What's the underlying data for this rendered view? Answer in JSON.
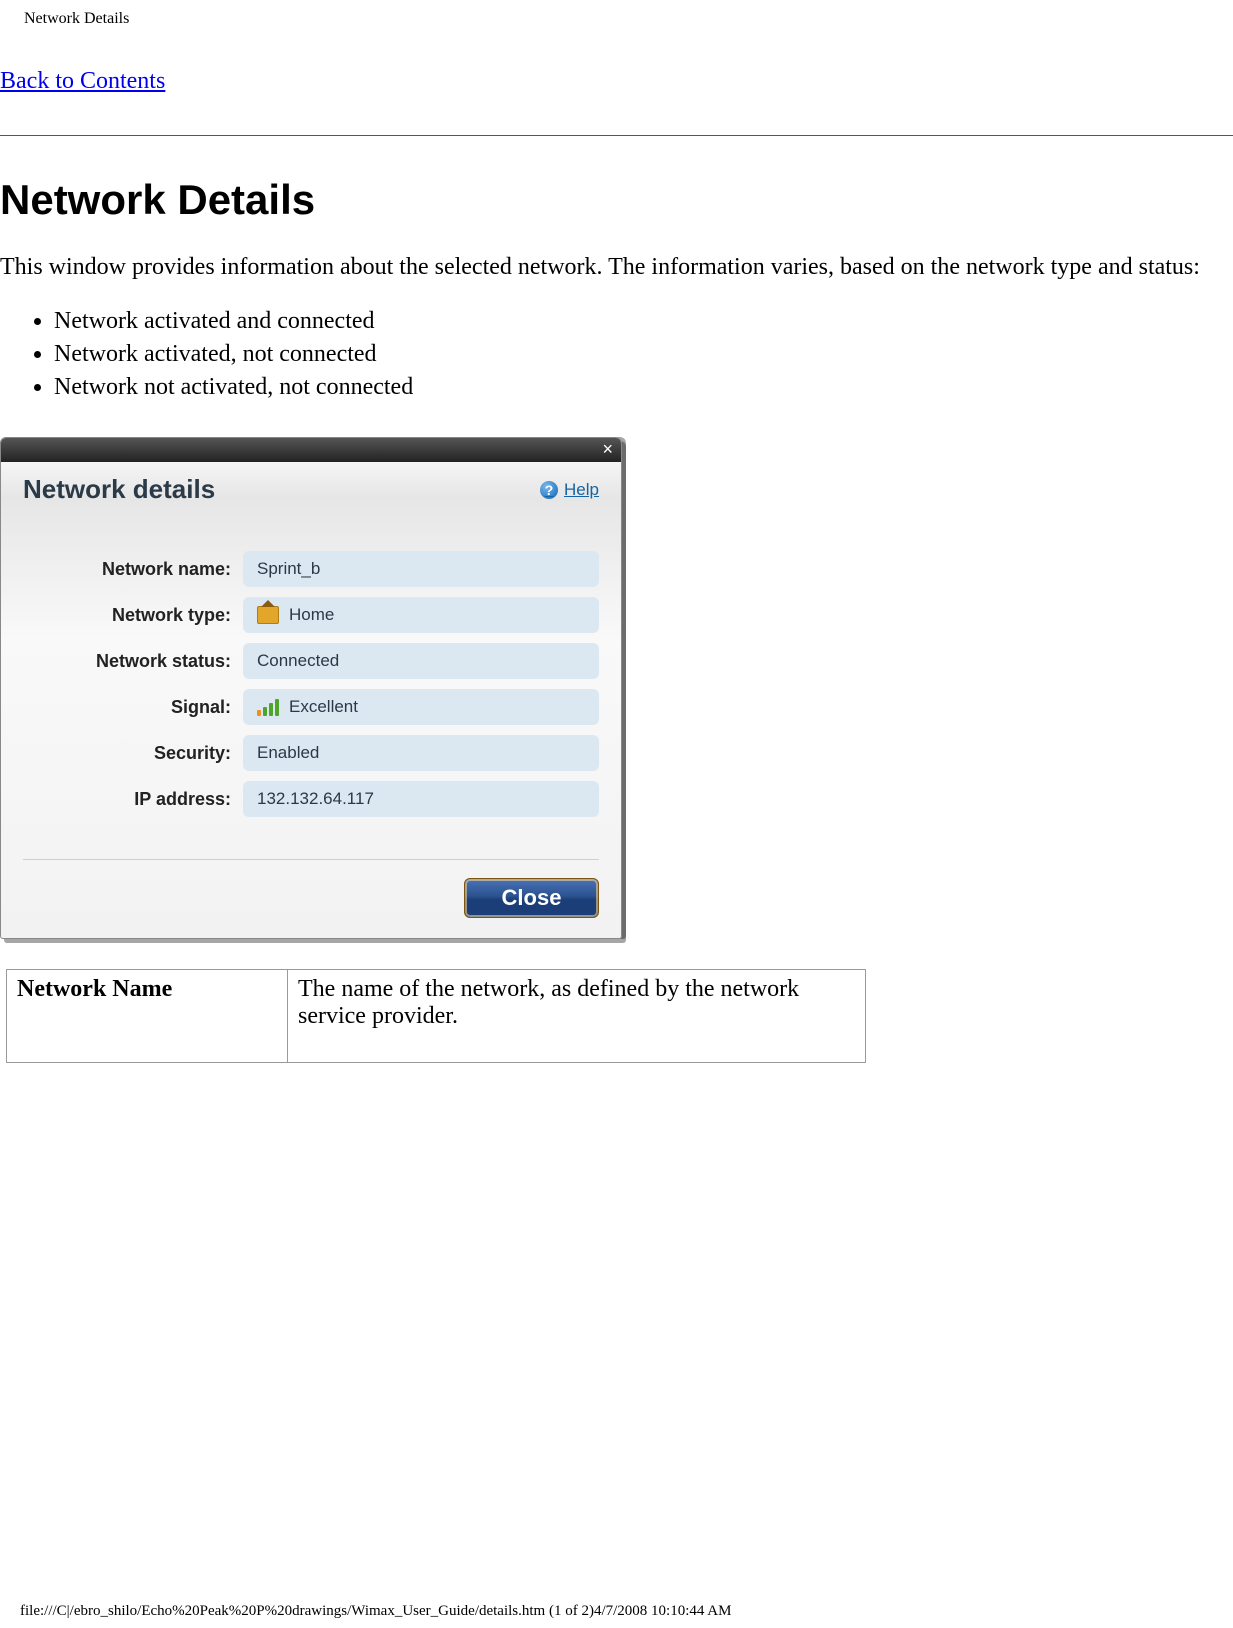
{
  "header_small_title": "Network Details",
  "back_link": "Back to Contents",
  "h1": "Network Details",
  "intro": "This window provides information about the selected network. The information varies, based on the network type and status:",
  "bullets": [
    "Network activated and connected",
    "Network activated, not connected",
    "Network not activated, not connected"
  ],
  "dialog": {
    "title": "Network details",
    "help_label": "Help",
    "close_x": "×",
    "fields": {
      "network_name": {
        "label": "Network name:",
        "value": "Sprint_b"
      },
      "network_type": {
        "label": "Network type:",
        "value": "Home"
      },
      "network_status": {
        "label": "Network status:",
        "value": "Connected"
      },
      "signal": {
        "label": "Signal:",
        "value": "Excellent"
      },
      "security": {
        "label": "Security:",
        "value": "Enabled"
      },
      "ip_address": {
        "label": "IP address:",
        "value": "132.132.64.117"
      }
    },
    "close_button": "Close"
  },
  "definition_table": {
    "term": "Network Name",
    "desc": "The name of the network, as defined by the network service provider."
  },
  "footer_path": "file:///C|/ebro_shilo/Echo%20Peak%20P%20drawings/Wimax_User_Guide/details.htm (1 of 2)4/7/2008 10:10:44 AM"
}
